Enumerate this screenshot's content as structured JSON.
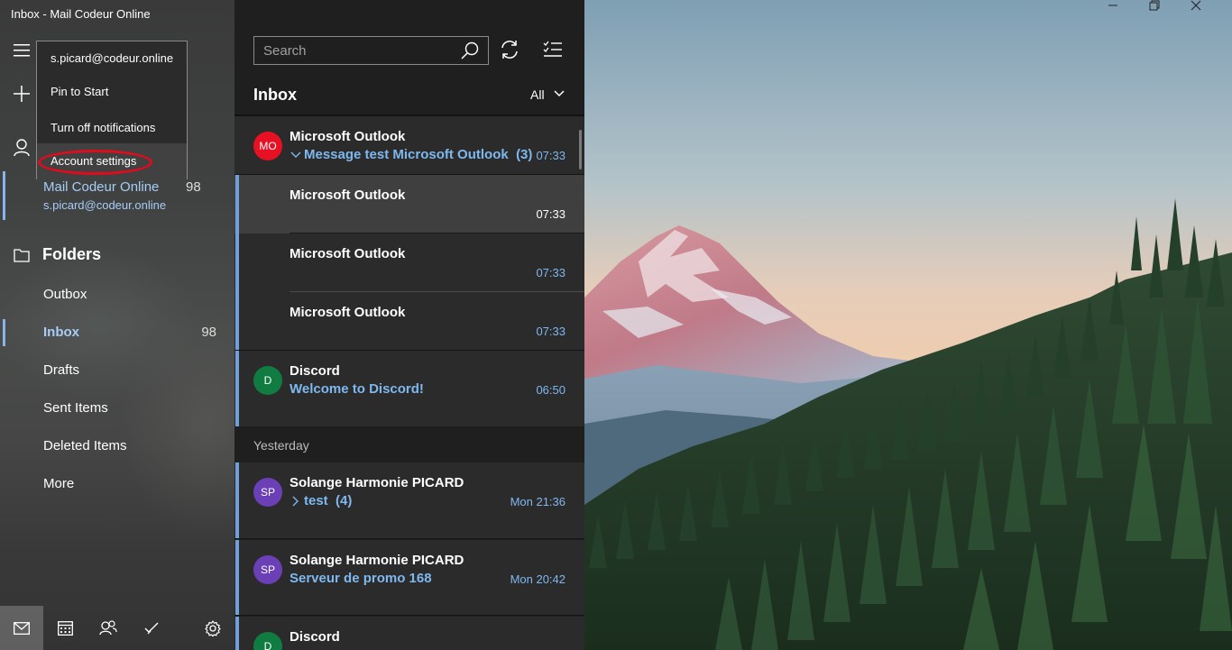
{
  "app": {
    "title": "Inbox - Mail Codeur Online"
  },
  "nav": {
    "account": {
      "name": "Mail Codeur Online",
      "unread": "98",
      "email": "s.picard@codeur.online"
    },
    "folders_heading": "Folders",
    "folders": [
      {
        "label": "Outbox",
        "count": ""
      },
      {
        "label": "Inbox",
        "count": "98"
      },
      {
        "label": "Drafts",
        "count": ""
      },
      {
        "label": "Sent Items",
        "count": ""
      },
      {
        "label": "Deleted Items",
        "count": ""
      },
      {
        "label": "More",
        "count": ""
      }
    ]
  },
  "context_menu": {
    "account": "s.picard@codeur.online",
    "pin": "Pin to Start",
    "notifications": "Turn off notifications",
    "settings": "Account settings"
  },
  "list": {
    "search_placeholder": "Search",
    "heading": "Inbox",
    "filter": "All",
    "group_yesterday": "Yesterday",
    "messages": [
      {
        "initials": "MO",
        "avatar_color": "#e81123",
        "sender": "Microsoft Outlook",
        "subject": "Message test Microsoft Outlook",
        "thread_count": "(3)",
        "time": "07:33"
      },
      {
        "sender": "Microsoft Outlook",
        "time": "07:33"
      },
      {
        "sender": "Microsoft Outlook",
        "time": "07:33"
      },
      {
        "sender": "Microsoft Outlook",
        "time": "07:33"
      },
      {
        "initials": "D",
        "avatar_color": "#107c41",
        "sender": "Discord",
        "subject": "Welcome to Discord!",
        "time": "06:50"
      },
      {
        "initials": "SP",
        "avatar_color": "#6b3fb5",
        "sender": "Solange Harmonie PICARD",
        "subject": "test",
        "thread_count": "(4)",
        "time": "Mon 21:36"
      },
      {
        "initials": "SP",
        "avatar_color": "#6b3fb5",
        "sender": "Solange Harmonie PICARD",
        "subject": "Serveur de promo 168",
        "time": "Mon 20:42"
      },
      {
        "initials": "D",
        "avatar_color": "#107c41",
        "sender": "Discord"
      }
    ]
  },
  "colors": {
    "accent": "#7fb8ef",
    "highlight_ring": "#e00b1c"
  }
}
